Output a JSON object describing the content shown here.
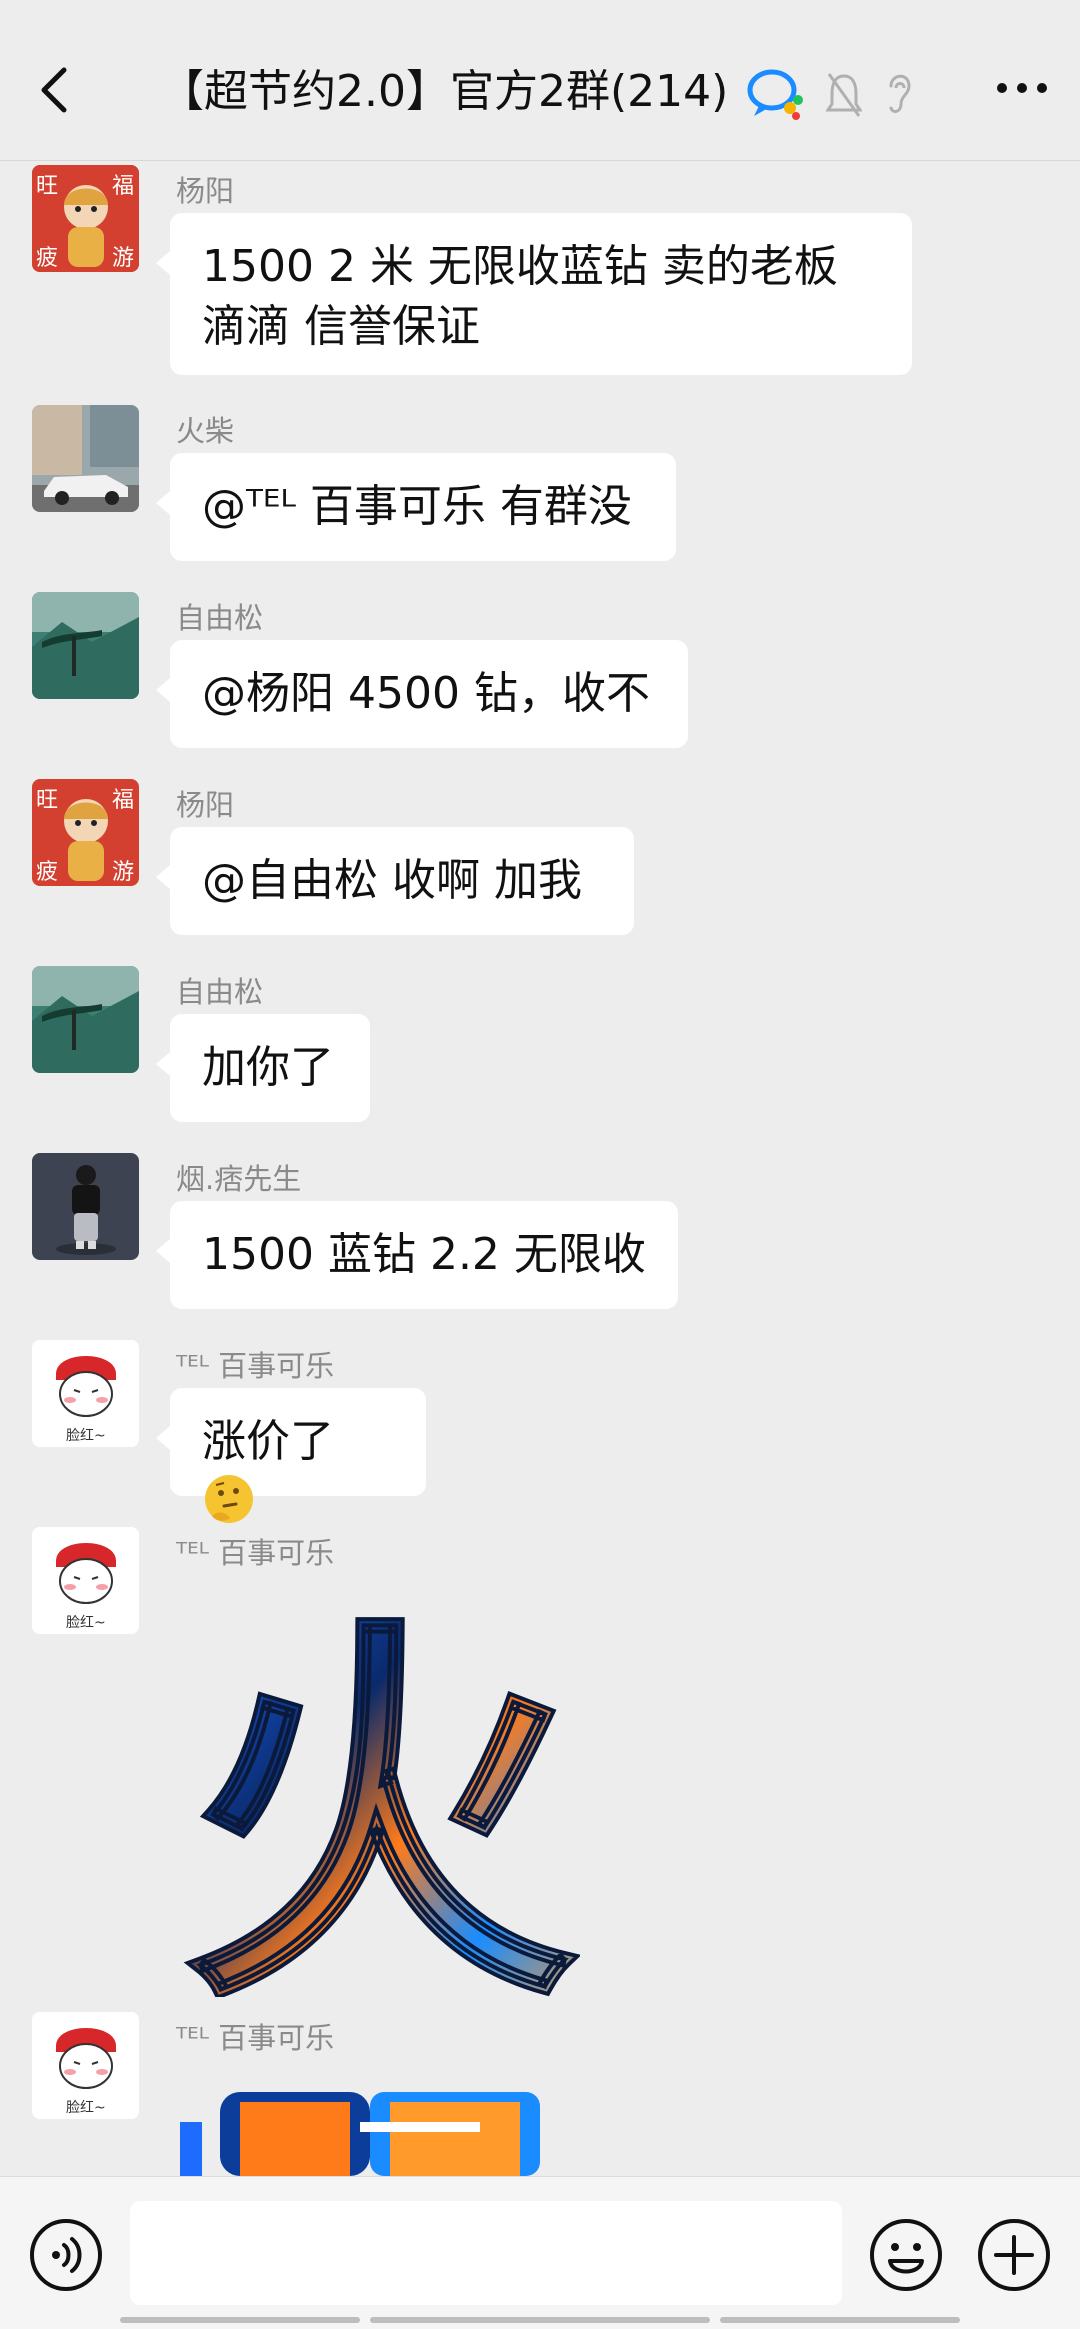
{
  "header": {
    "title": "【超节约2.0】官方2群(214)",
    "icons": [
      "back-icon",
      "chat-bubble-icon",
      "mute-bell-icon",
      "ear-icon",
      "more-icon"
    ]
  },
  "messages": [
    {
      "sender": "杨阳",
      "text": "1500 2 米 无限收蓝钻 卖的老板滴滴 信誉保证",
      "avatar": "tiger-avatar"
    },
    {
      "sender": "火柴",
      "text": "@ᵀᴱᴸ 百事可乐  有群没",
      "avatar": "car-avatar"
    },
    {
      "sender": "自由松",
      "text": "@杨阳  4500 钻，收不",
      "avatar": "pine-avatar"
    },
    {
      "sender": "杨阳",
      "text": "@自由松  收啊 加我",
      "avatar": "tiger-avatar"
    },
    {
      "sender": "自由松",
      "text": "加你了",
      "avatar": "pine-avatar"
    },
    {
      "sender": "烟.痞先生",
      "text": "1500 蓝钻 2.2  无限收",
      "avatar": "person-avatar"
    },
    {
      "sender": "ᵀᴱᴸ 百事可乐",
      "text": "涨价了",
      "avatar": "cartoon-avatar"
    },
    {
      "sender": "ᵀᴱᴸ 百事可乐",
      "sticker_char": "火",
      "avatar": "cartoon-avatar"
    },
    {
      "sender": "ᵀᴱᴸ 百事可乐",
      "avatar": "cartoon-avatar"
    }
  ],
  "avatar_caption": "脸红~",
  "tiger_chars": [
    "旺",
    "福",
    "疲",
    "游"
  ],
  "footer": {
    "icons": [
      "voice-icon",
      "emoji-icon",
      "plus-icon"
    ]
  }
}
